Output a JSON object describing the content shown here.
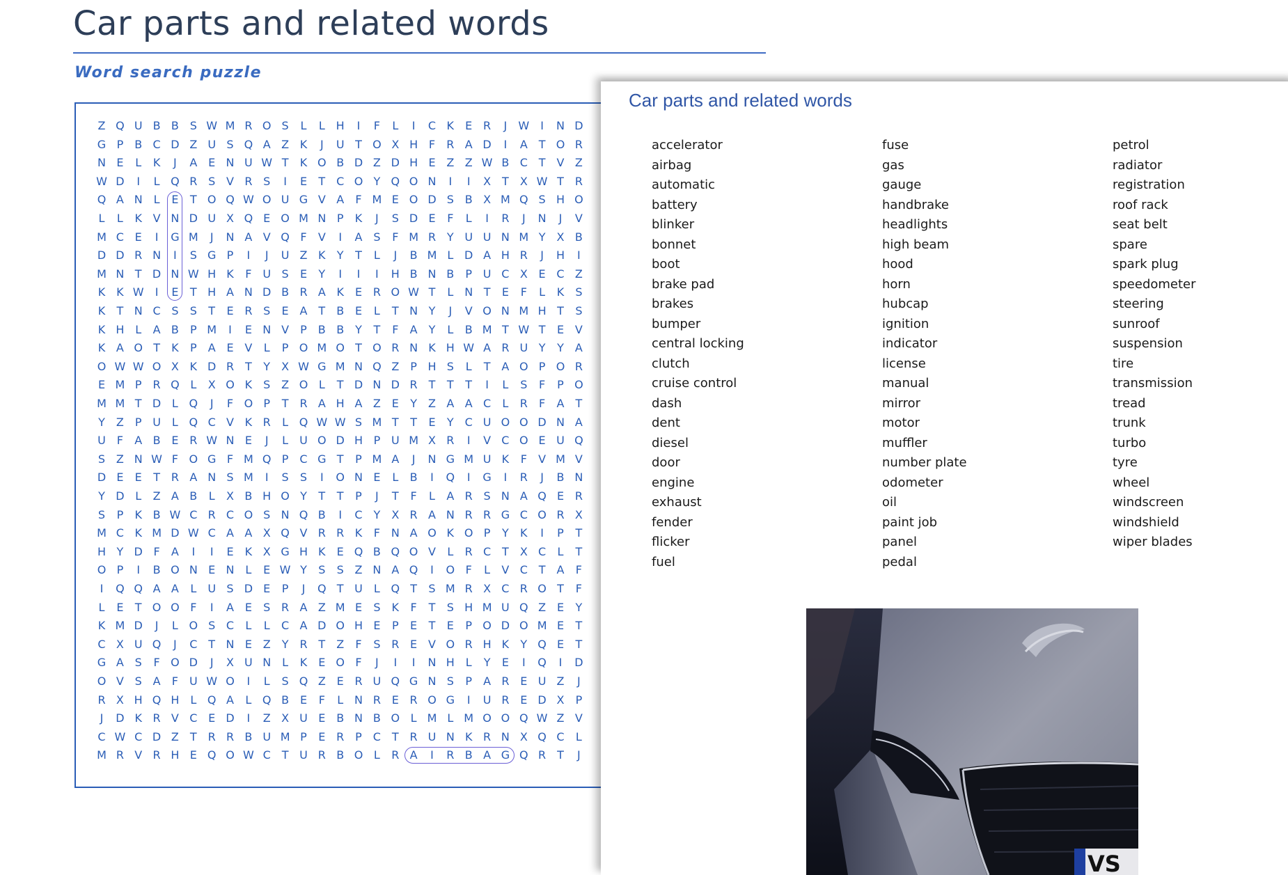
{
  "worksheet": {
    "title": "Car parts and related words",
    "subtitle": "Word search puzzle"
  },
  "puzzle": {
    "rows": [
      "ZQUBBSWMROSLLHIFLICKERJWIND",
      "GPBCDZUSQAZKJUTOXHFRADIATOR",
      "NELKJAENUWTKOBDZDHEZZWBCTVZ",
      "WDILQRSVRSIETCOYQONIIXTXWTR",
      "QANLETOQWOUGVAFMEODSBXMQSHO",
      "LLKVNDUXQEOMNPKJSDEFLIRJNJV",
      "MCEIGMJNAVQFVIASFMRYUUNMYXB",
      "DDRNISGPIJUZKYTLJBMLDAHRJHI",
      "MNTDNWHKFUSEYIIIHBNBPUCXECZ",
      "KKWIETHANDBRAKEROWTLNTEFLKS",
      "KTNCSSTERSEATBELTNYJVONMHTS",
      "KHLABPMIENVPBBYTFAYLBMTWTEV",
      "KAOTKPAEVLPOMOTORNKHWARUYYA",
      "OWWOXKDRTYXWGMNQZPHSLTAOPOR",
      "EMPRQLXOKSZOLTDNDRTTTILSFPO",
      "MMTDLQJFOPTRAHAZEYZAACLRFAT",
      "YZPULQCVKRLQWWSMTTEYCUOODNA",
      "UFABERWNEJLUODHPUMXRIVCOEUQ",
      "SZNWFOGFMQPCGTPMAJNGMUKFVMV",
      "DEETRANSMISSIONELBIQIGIRJBN",
      "YDLZABLXBHOYTTPJTFLARSNAQER",
      "SPKBWCRCOSNQBICYXRANRRGCORX",
      "MCKMDWCAAXQVRRKFNAOKOPYKIPT",
      "HYDFAIIEKXGHKEQBQOVLRCTXCLT",
      "OPIBONENLEWYSSZNAQIOFLVCTAF",
      "IQQAALUSDEPJQTULQTSMRXCROTF",
      "LETOOFIAESRAZMESKFTSHMUQZEY",
      "KMDJLOSCLLCADOHEPETEPODOMET",
      "CXUQJCTNEZYRTZFSREVORHKYQET",
      "GASFODJXUNLKEOFJIINHLYEIQID",
      "OVSAFUWOILSQZERUQGNSPAREUZJ",
      "RXHQHLQALQBEFLNREROGIUREDXP",
      "JDKRVCEDIZXUEBNBOLMLMOOQWZV",
      "CWCDZTRRBUMPERPCTRUNKRNXQCL",
      "MRVRHEQOWCTURBOLRAIRBAGQRTJ"
    ],
    "found": [
      {
        "word": "ENGINE",
        "row": 4,
        "col": 4,
        "dir": "down",
        "length": 6
      },
      {
        "word": "AIRBAG",
        "row": 34,
        "col": 17,
        "dir": "across",
        "length": 6
      }
    ]
  },
  "word_list": {
    "title": "Car parts and related words",
    "columns": [
      [
        "accelerator",
        "airbag",
        "automatic",
        "battery",
        "blinker",
        "bonnet",
        "boot",
        "brake pad",
        "brakes",
        "bumper",
        "central locking",
        "clutch",
        "cruise control",
        "dash",
        "dent",
        "diesel",
        "door",
        "engine",
        "exhaust",
        "fender",
        "flicker",
        "fuel"
      ],
      [
        "fuse",
        "gas",
        "gauge",
        "handbrake",
        "headlights",
        "high beam",
        "hood",
        "horn",
        "hubcap",
        "ignition",
        "indicator",
        "license",
        "manual",
        "mirror",
        "motor",
        "muffler",
        "number plate",
        "odometer",
        "oil",
        "paint job",
        "panel",
        "pedal"
      ],
      [
        "petrol",
        "radiator",
        "registration",
        "roof rack",
        "seat belt",
        "spare",
        "spark plug",
        "speedometer",
        "steering",
        "sunroof",
        "suspension",
        "tire",
        "transmission",
        "tread",
        "trunk",
        "turbo",
        "tyre",
        "wheel",
        "windscreen",
        "windshield",
        "wiper blades"
      ]
    ]
  },
  "photo": {
    "subject": "car-front-night",
    "plate_text": "VS"
  },
  "colors": {
    "title": "#2d3e58",
    "accent": "#3f6cc4",
    "grid_letters": "#2a5db6",
    "highlight": "#6a5fd6",
    "list_title": "#3056a6"
  }
}
